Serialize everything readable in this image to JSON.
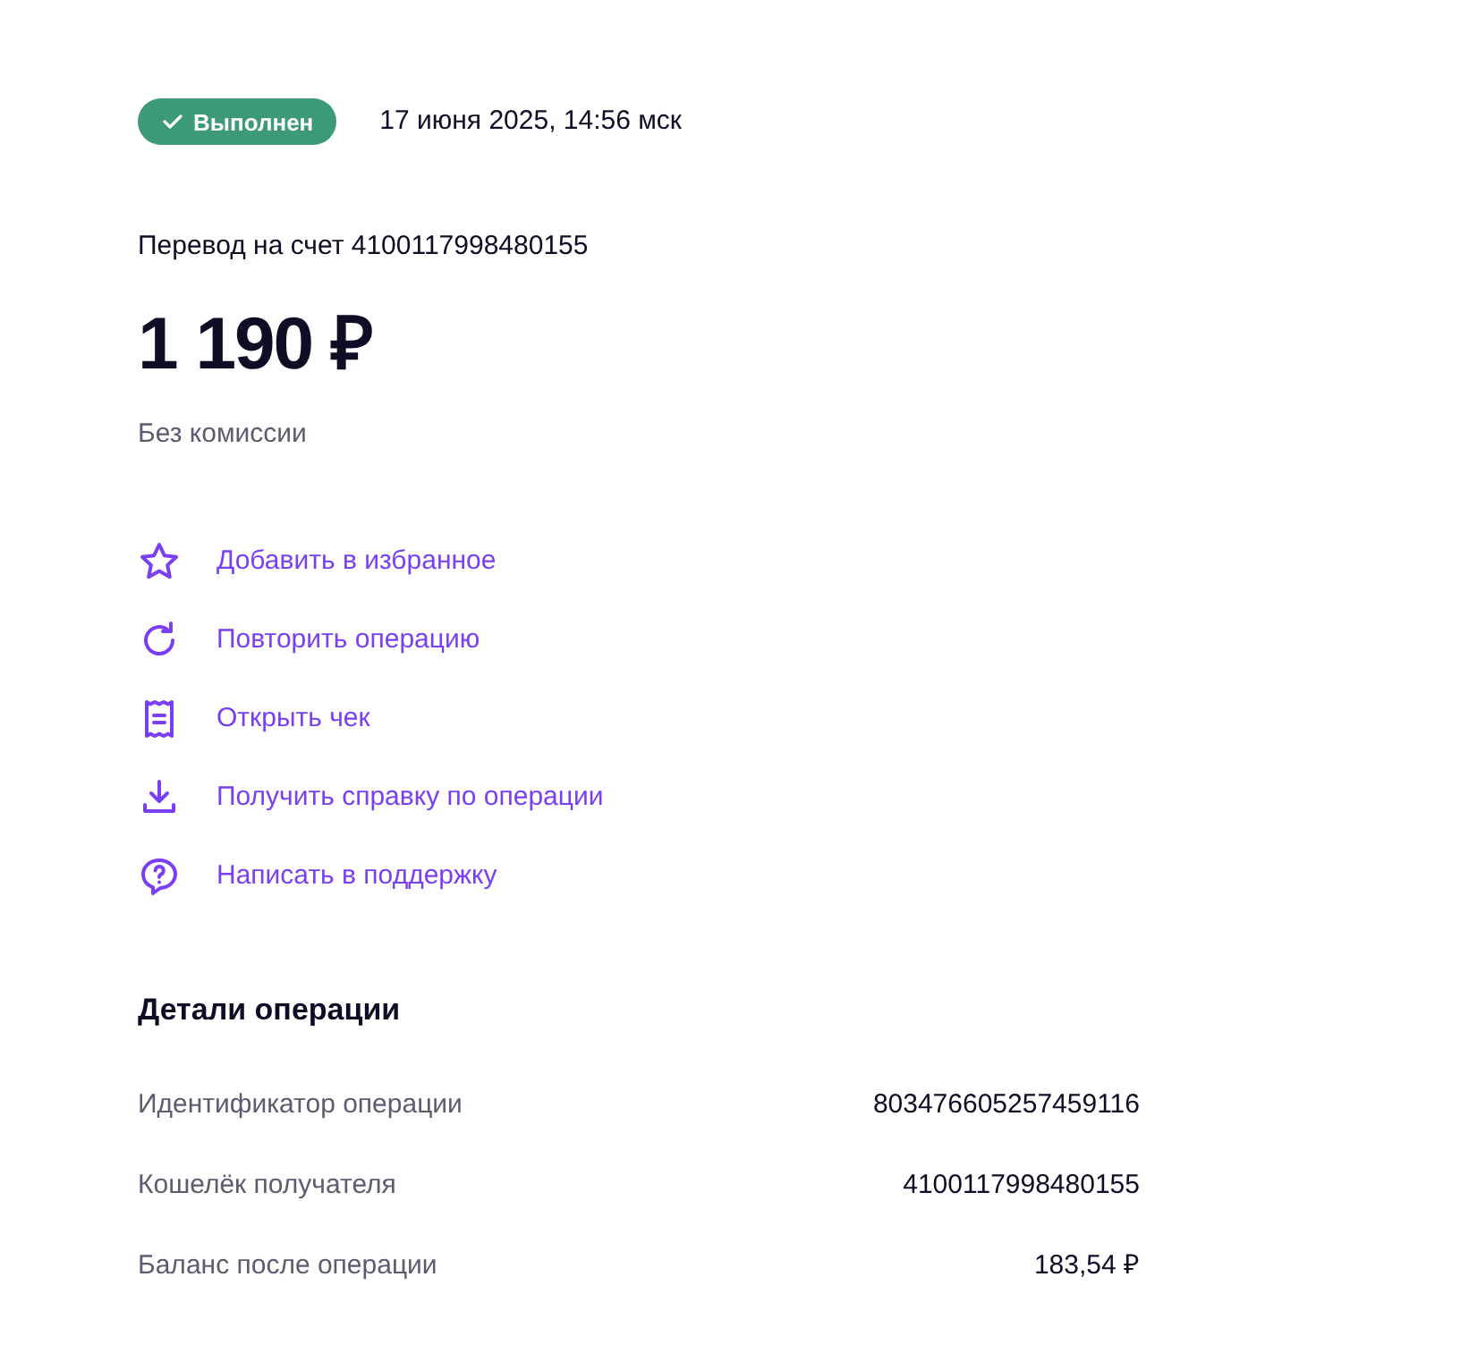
{
  "status": {
    "label": "Выполнен"
  },
  "date": "17 июня 2025, 14:56 мск",
  "transfer": {
    "description": "Перевод на счет 4100117998480155",
    "amount": "1 190 ₽",
    "fee": "Без комиссии"
  },
  "actions": [
    {
      "kind": "favorite",
      "label": "Добавить в избранное"
    },
    {
      "kind": "repeat",
      "label": "Повторить операцию"
    },
    {
      "kind": "receipt",
      "label": "Открыть чек"
    },
    {
      "kind": "download",
      "label": "Получить справку по операции"
    },
    {
      "kind": "support",
      "label": "Написать в поддержку"
    }
  ],
  "details": {
    "title": "Детали операции",
    "rows": [
      {
        "label": "Идентификатор операции",
        "value": "803476605257459116"
      },
      {
        "label": "Кошелёк получателя",
        "value": "4100117998480155"
      },
      {
        "label": "Баланс после операции",
        "value": "183,54 ₽"
      }
    ]
  }
}
